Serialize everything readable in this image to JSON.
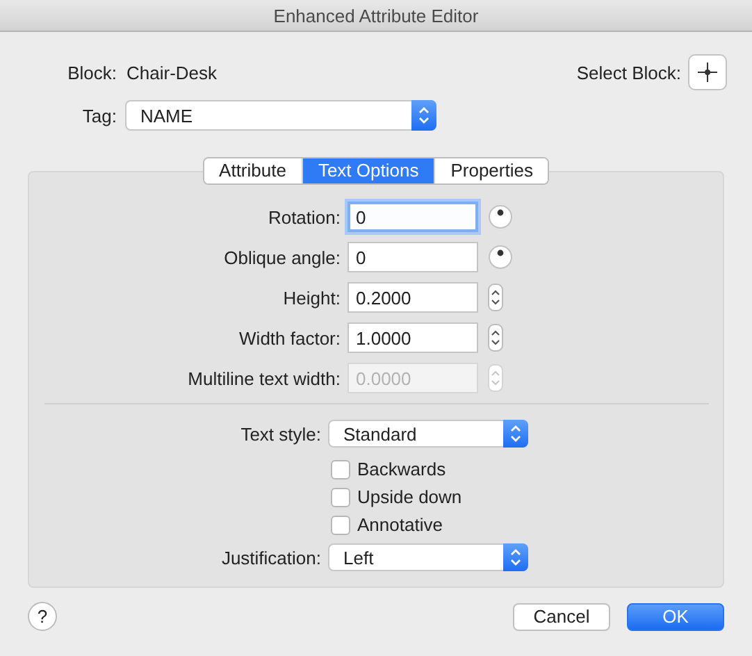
{
  "window": {
    "title": "Enhanced Attribute Editor"
  },
  "block": {
    "label": "Block:",
    "value": "Chair-Desk"
  },
  "select_block": {
    "label": "Select Block:"
  },
  "tag": {
    "label": "Tag:",
    "value": "NAME"
  },
  "tabs": [
    {
      "label": "Attribute",
      "selected": false
    },
    {
      "label": "Text Options",
      "selected": true
    },
    {
      "label": "Properties",
      "selected": false
    }
  ],
  "fields": [
    {
      "label": "Rotation:",
      "value": "0",
      "kind": "dial",
      "focused": true,
      "disabled": false
    },
    {
      "label": "Oblique angle:",
      "value": "0",
      "kind": "dial",
      "focused": false,
      "disabled": false
    },
    {
      "label": "Height:",
      "value": "0.2000",
      "kind": "stepper",
      "focused": false,
      "disabled": false
    },
    {
      "label": "Width factor:",
      "value": "1.0000",
      "kind": "stepper",
      "focused": false,
      "disabled": false
    },
    {
      "label": "Multiline text width:",
      "value": "0.0000",
      "kind": "stepper",
      "focused": false,
      "disabled": true
    }
  ],
  "text_style": {
    "label": "Text style:",
    "value": "Standard"
  },
  "checkboxes": [
    {
      "label": "Backwards",
      "checked": false
    },
    {
      "label": "Upside down",
      "checked": false
    },
    {
      "label": "Annotative",
      "checked": false
    }
  ],
  "justification": {
    "label": "Justification:",
    "value": "Left"
  },
  "help": "?",
  "buttons": [
    {
      "label": "Cancel",
      "kind": "secondary"
    },
    {
      "label": "OK",
      "kind": "primary"
    }
  ]
}
